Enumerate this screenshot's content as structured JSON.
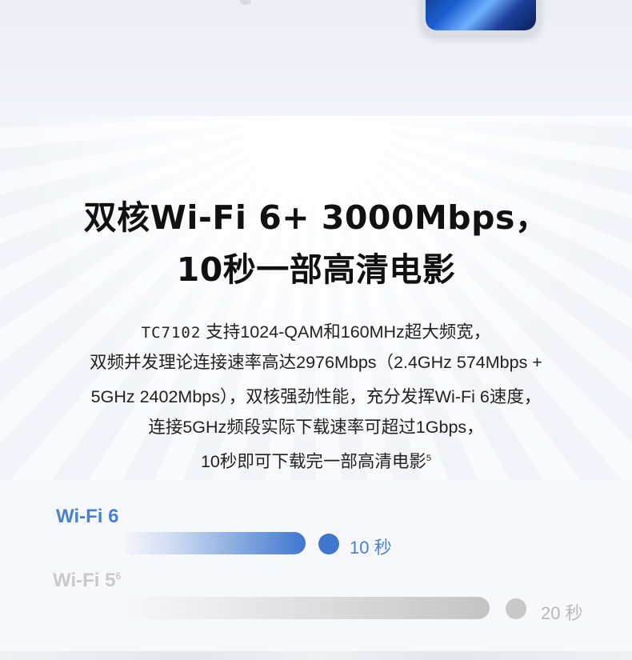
{
  "headline": {
    "line1": "双核Wi-Fi 6+ 3000Mbps，",
    "line2": "10秒一部高清电影"
  },
  "body": {
    "model": "TC7102",
    "line1_rest": " 支持1024-QAM和160MHz超大频宽，",
    "line2": "双频并发理论连接速率高达2976Mbps（2.4GHz 574Mbps +",
    "line3": "5GHz 2402Mbps），双核强劲性能，充分发挥Wi-Fi 6速度，",
    "line4": "连接5GHz频段实际下载速率可超过1Gbps，",
    "line5": "10秒即可下载完一部高清电影",
    "line5_sup": "5"
  },
  "comparison": {
    "wifi6": {
      "label": "Wi-Fi 6",
      "time": "10 秒",
      "seconds": 10,
      "color": "#3f77cf"
    },
    "wifi5": {
      "label": "Wi-Fi 5",
      "label_sup": "6",
      "time": "20 秒",
      "seconds": 20,
      "color": "#c8c8c8"
    }
  }
}
